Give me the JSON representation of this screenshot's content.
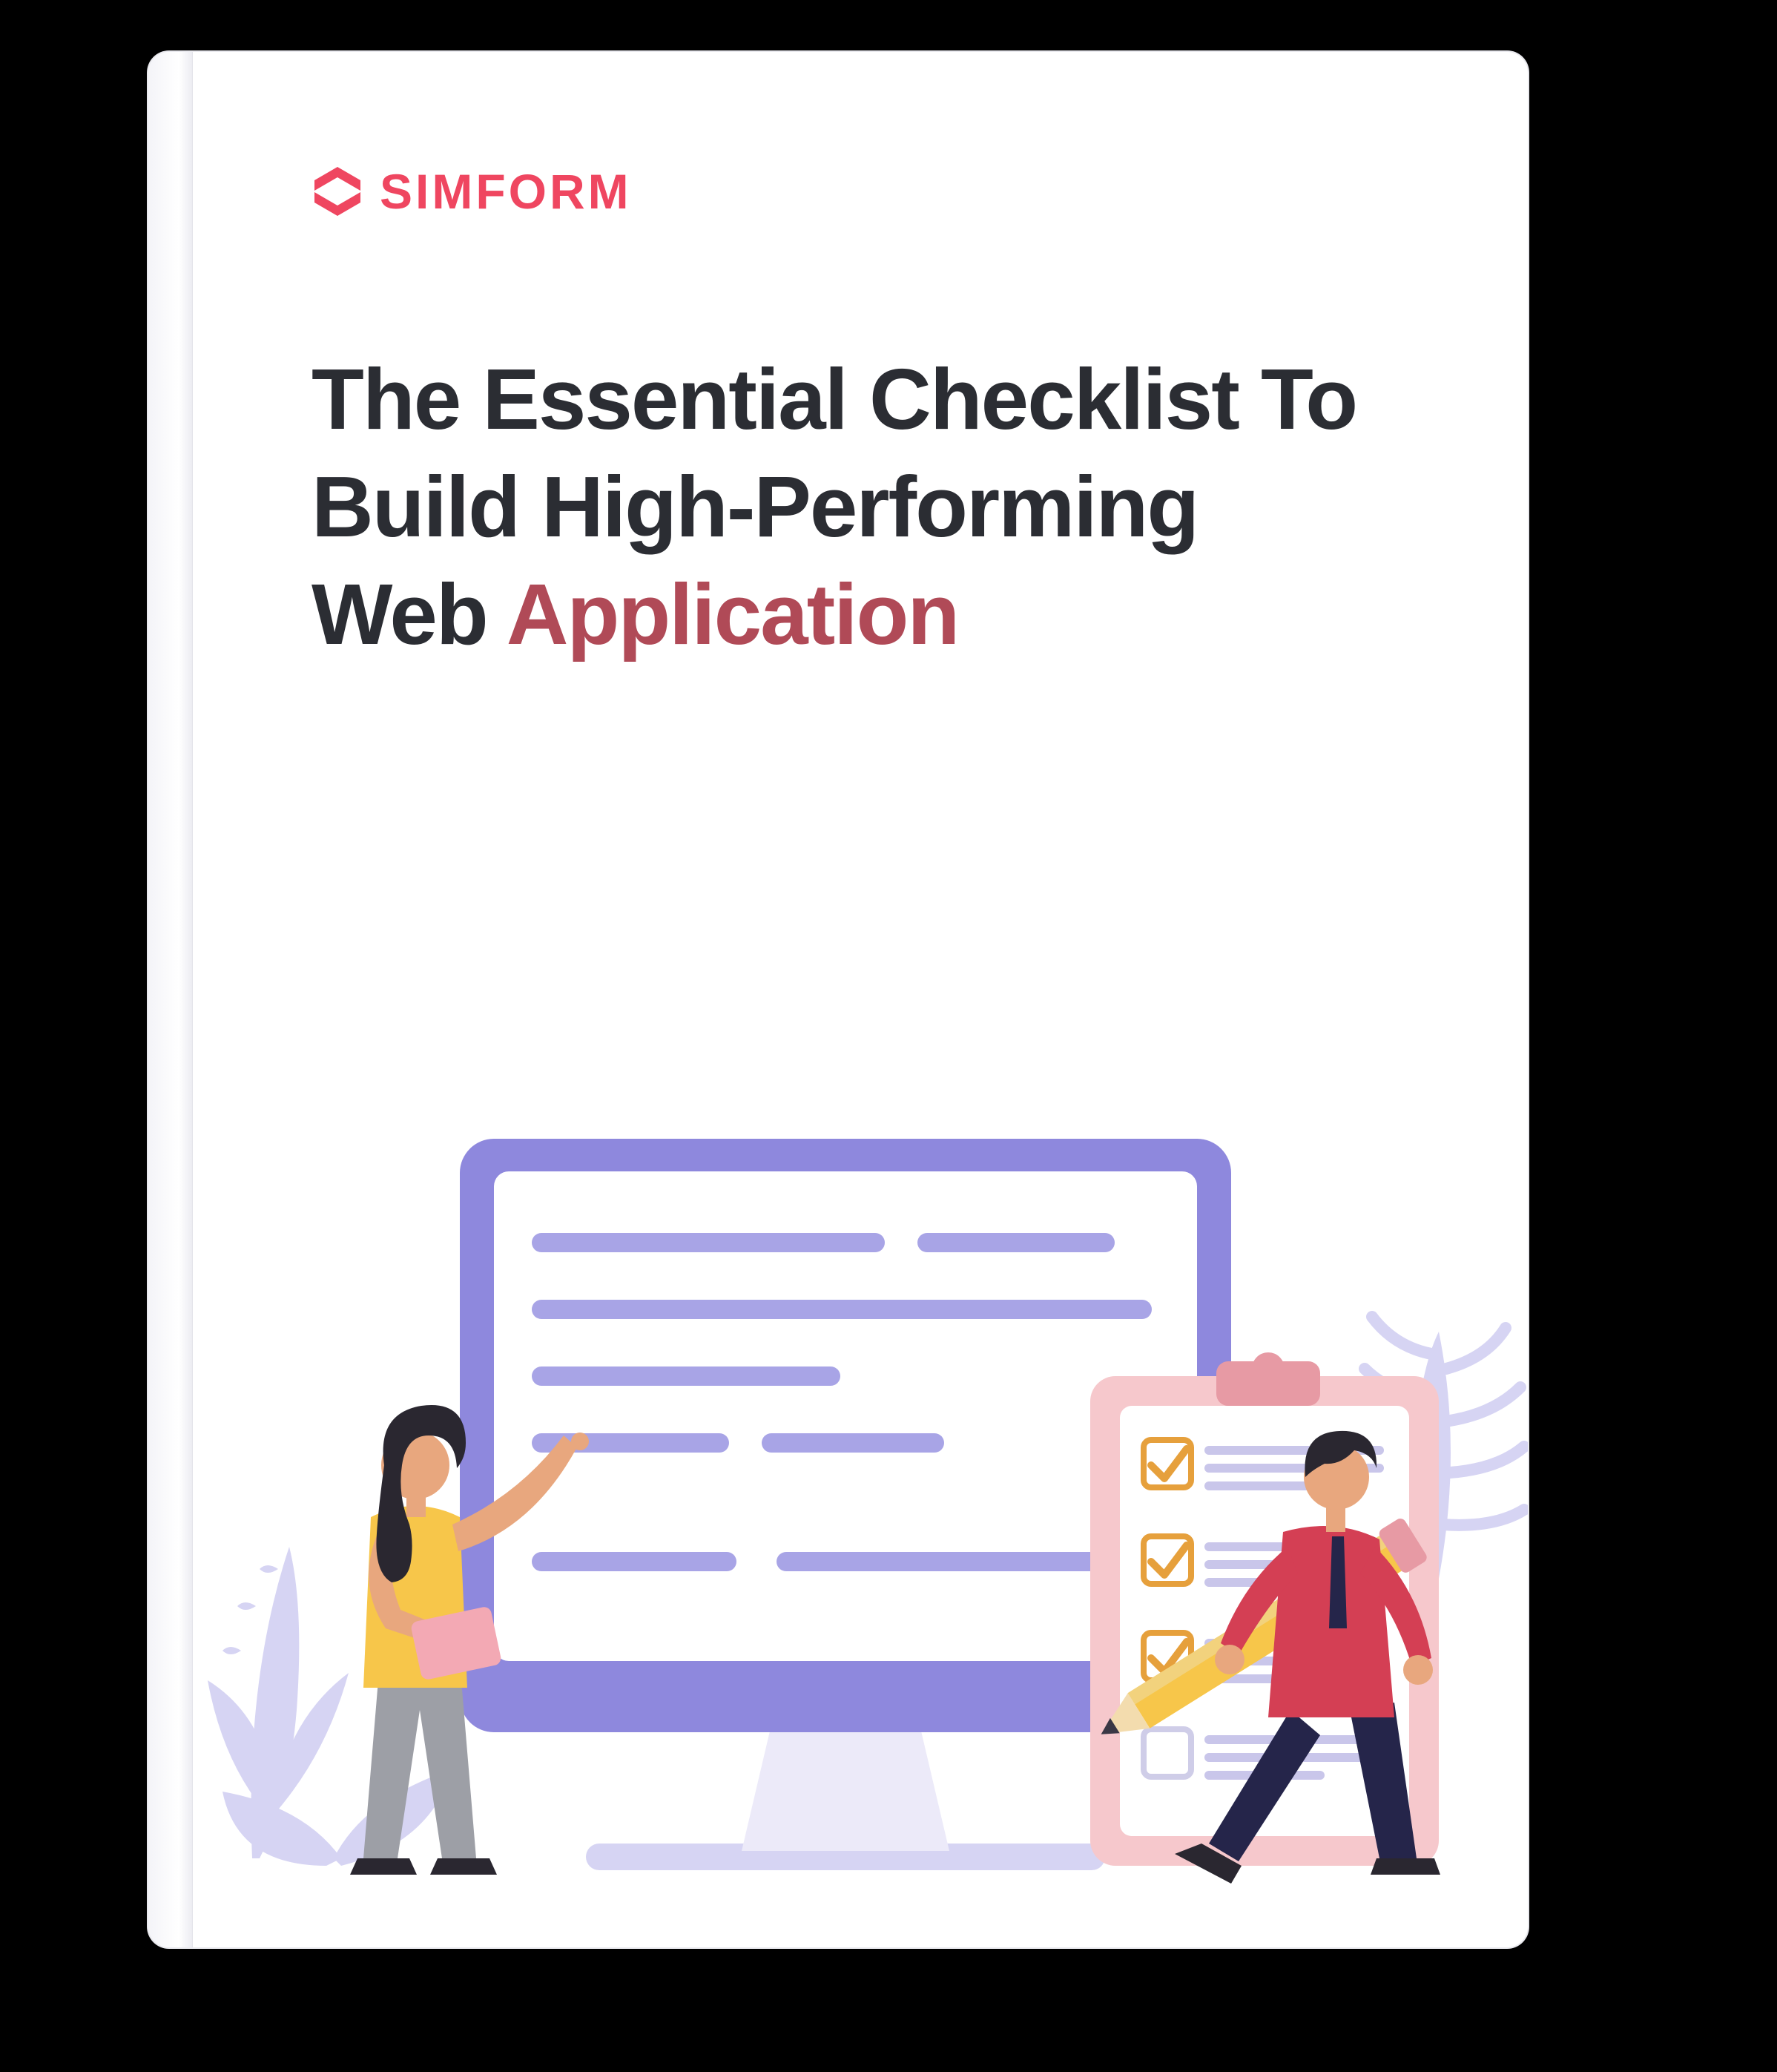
{
  "brand": {
    "name": "SIMFORM"
  },
  "title": {
    "line1": "The Essential Checklist To",
    "line2": "Build High-Performing",
    "line3_a": "Web ",
    "line3_b": "Application"
  },
  "colors": {
    "brand": "#ef4660",
    "heading": "#2b2d33",
    "accent": "#b04a57",
    "lilac": "#a8a4e6",
    "lilac_light": "#d6d4f3",
    "pink": "#f6c8cc",
    "pink_dark": "#e79aa4",
    "yellow": "#f7c64a",
    "orange": "#e6a03c",
    "skin": "#e8a77e",
    "hair": "#2a2730",
    "grey": "#9d9fa6",
    "red": "#d43f54",
    "navy": "#25254a"
  }
}
